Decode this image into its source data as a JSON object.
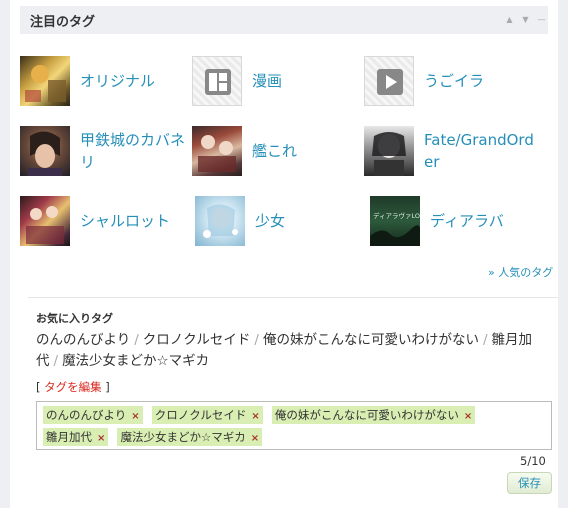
{
  "header": {
    "title": "注目のタグ"
  },
  "featured_tags": [
    {
      "label": "オリジナル"
    },
    {
      "label": "漫画"
    },
    {
      "label": "うごイラ"
    },
    {
      "label": "甲鉄城のカバネリ"
    },
    {
      "label": "艦これ"
    },
    {
      "label": "Fate/GrandOrder"
    },
    {
      "label": "シャルロット"
    },
    {
      "label": "少女"
    },
    {
      "label": "ディアラバ"
    }
  ],
  "more_link": "» 人気のタグ",
  "favorites": {
    "title": "お気に入りタグ",
    "items": [
      "のんのんびより",
      "クロノクルセイド",
      "俺の妹がこんなに可愛いわけがない",
      "雛月加代",
      "魔法少女まどか☆マギカ"
    ],
    "separator": "/",
    "edit_open": "[ ",
    "edit_link": "タグを編集",
    "edit_close": " ]",
    "chips": [
      "のんのんびより",
      "クロノクルセイド",
      "俺の妹がこんなに可愛いわけがない",
      "雛月加代",
      "魔法少女まどか☆マギカ"
    ],
    "chip_remove": "×",
    "count": "5/10",
    "save_label": "保存"
  },
  "thumbnail_text": {
    "diabolik": "ディアラヴァLOG"
  }
}
